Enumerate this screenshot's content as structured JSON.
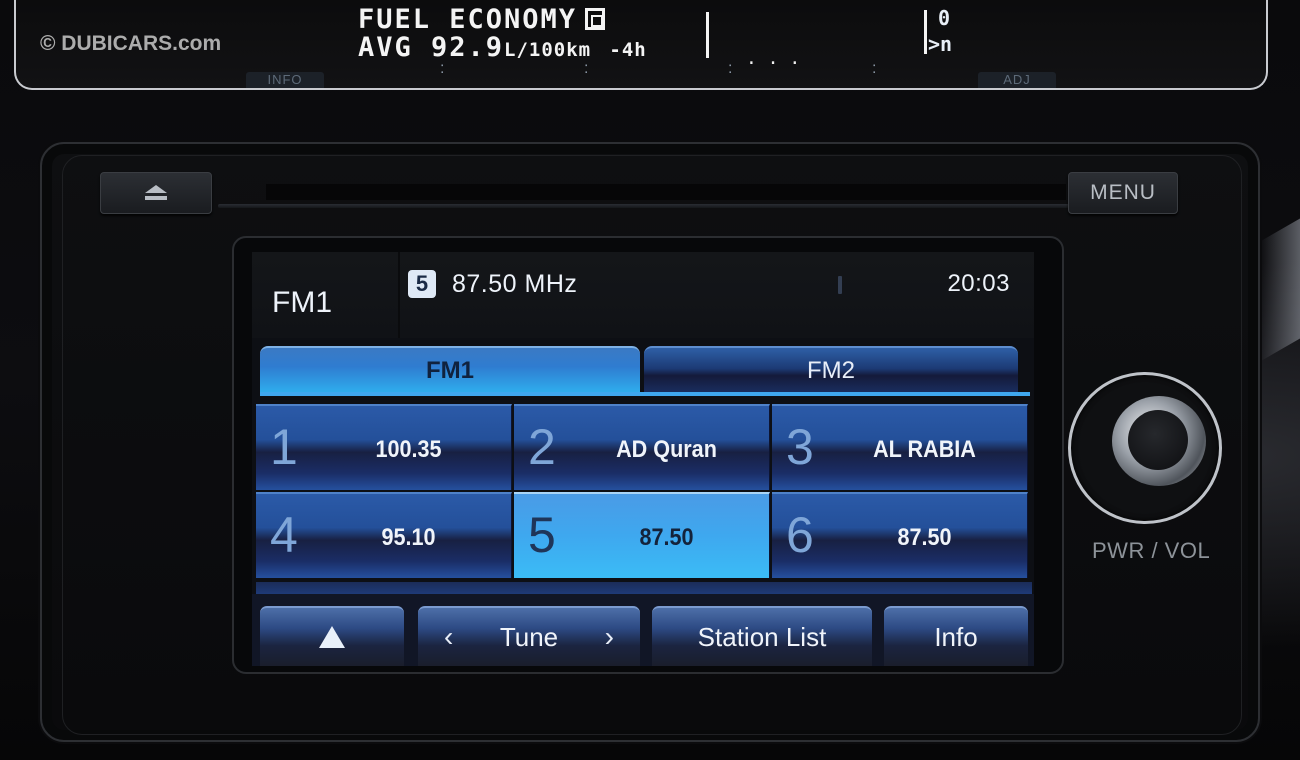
{
  "watermark": "© DUBICARS.com",
  "info_display": {
    "line1": "FUEL ECONOMY",
    "line2_prefix": "AVG 92.9",
    "line2_unit": "L/100km",
    "line2_suffix": "-4h",
    "right_top": "0",
    "right_bottom": ">n",
    "softkeys": {
      "left": "INFO",
      "right": "ADJ"
    },
    "dots": ".    .    ."
  },
  "head_unit": {
    "eject_icon": "eject-icon",
    "menu_label": "MENU",
    "knob_label": "PWR / VOL"
  },
  "screen": {
    "band": "FM1",
    "preset_badge": "5",
    "frequency": "87.50 MHz",
    "clock": "20:03",
    "status_icon": "bluetooth-icon",
    "tabs": [
      {
        "label": "FM1",
        "active": true
      },
      {
        "label": "FM2",
        "active": false
      }
    ],
    "presets": [
      {
        "number": "1",
        "name": "100.35"
      },
      {
        "number": "2",
        "name": "AD Quran"
      },
      {
        "number": "3",
        "name": "AL RABIA"
      },
      {
        "number": "4",
        "name": "95.10"
      },
      {
        "number": "5",
        "name": "87.50",
        "selected": true
      },
      {
        "number": "6",
        "name": "87.50"
      }
    ],
    "actions": {
      "up_icon": "up-arrow-icon",
      "tune_prev": "‹",
      "tune_label": "Tune",
      "tune_next": "›",
      "station_list": "Station List",
      "info": "Info"
    },
    "colors": {
      "active_tab": "#2fb0ef",
      "selected_preset": "#3ea8ef",
      "preset_bg": "#24509a"
    }
  }
}
